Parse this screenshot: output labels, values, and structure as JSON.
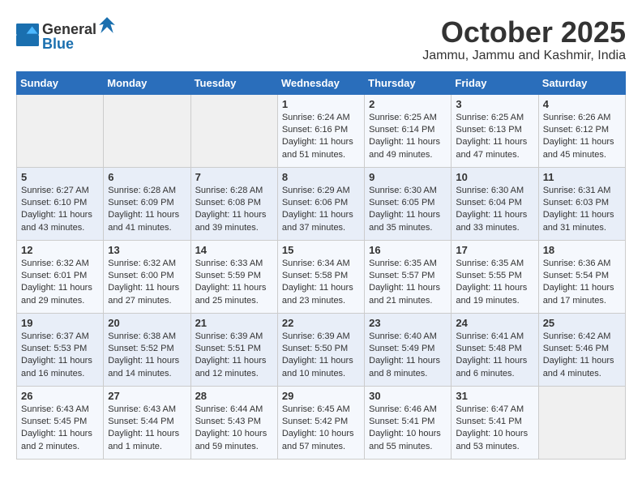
{
  "logo": {
    "general": "General",
    "blue": "Blue"
  },
  "header": {
    "month": "October 2025",
    "location": "Jammu, Jammu and Kashmir, India"
  },
  "weekdays": [
    "Sunday",
    "Monday",
    "Tuesday",
    "Wednesday",
    "Thursday",
    "Friday",
    "Saturday"
  ],
  "weeks": [
    [
      {
        "day": "",
        "sunrise": "",
        "sunset": "",
        "daylight": ""
      },
      {
        "day": "",
        "sunrise": "",
        "sunset": "",
        "daylight": ""
      },
      {
        "day": "",
        "sunrise": "",
        "sunset": "",
        "daylight": ""
      },
      {
        "day": "1",
        "sunrise": "Sunrise: 6:24 AM",
        "sunset": "Sunset: 6:16 PM",
        "daylight": "Daylight: 11 hours and 51 minutes."
      },
      {
        "day": "2",
        "sunrise": "Sunrise: 6:25 AM",
        "sunset": "Sunset: 6:14 PM",
        "daylight": "Daylight: 11 hours and 49 minutes."
      },
      {
        "day": "3",
        "sunrise": "Sunrise: 6:25 AM",
        "sunset": "Sunset: 6:13 PM",
        "daylight": "Daylight: 11 hours and 47 minutes."
      },
      {
        "day": "4",
        "sunrise": "Sunrise: 6:26 AM",
        "sunset": "Sunset: 6:12 PM",
        "daylight": "Daylight: 11 hours and 45 minutes."
      }
    ],
    [
      {
        "day": "5",
        "sunrise": "Sunrise: 6:27 AM",
        "sunset": "Sunset: 6:10 PM",
        "daylight": "Daylight: 11 hours and 43 minutes."
      },
      {
        "day": "6",
        "sunrise": "Sunrise: 6:28 AM",
        "sunset": "Sunset: 6:09 PM",
        "daylight": "Daylight: 11 hours and 41 minutes."
      },
      {
        "day": "7",
        "sunrise": "Sunrise: 6:28 AM",
        "sunset": "Sunset: 6:08 PM",
        "daylight": "Daylight: 11 hours and 39 minutes."
      },
      {
        "day": "8",
        "sunrise": "Sunrise: 6:29 AM",
        "sunset": "Sunset: 6:06 PM",
        "daylight": "Daylight: 11 hours and 37 minutes."
      },
      {
        "day": "9",
        "sunrise": "Sunrise: 6:30 AM",
        "sunset": "Sunset: 6:05 PM",
        "daylight": "Daylight: 11 hours and 35 minutes."
      },
      {
        "day": "10",
        "sunrise": "Sunrise: 6:30 AM",
        "sunset": "Sunset: 6:04 PM",
        "daylight": "Daylight: 11 hours and 33 minutes."
      },
      {
        "day": "11",
        "sunrise": "Sunrise: 6:31 AM",
        "sunset": "Sunset: 6:03 PM",
        "daylight": "Daylight: 11 hours and 31 minutes."
      }
    ],
    [
      {
        "day": "12",
        "sunrise": "Sunrise: 6:32 AM",
        "sunset": "Sunset: 6:01 PM",
        "daylight": "Daylight: 11 hours and 29 minutes."
      },
      {
        "day": "13",
        "sunrise": "Sunrise: 6:32 AM",
        "sunset": "Sunset: 6:00 PM",
        "daylight": "Daylight: 11 hours and 27 minutes."
      },
      {
        "day": "14",
        "sunrise": "Sunrise: 6:33 AM",
        "sunset": "Sunset: 5:59 PM",
        "daylight": "Daylight: 11 hours and 25 minutes."
      },
      {
        "day": "15",
        "sunrise": "Sunrise: 6:34 AM",
        "sunset": "Sunset: 5:58 PM",
        "daylight": "Daylight: 11 hours and 23 minutes."
      },
      {
        "day": "16",
        "sunrise": "Sunrise: 6:35 AM",
        "sunset": "Sunset: 5:57 PM",
        "daylight": "Daylight: 11 hours and 21 minutes."
      },
      {
        "day": "17",
        "sunrise": "Sunrise: 6:35 AM",
        "sunset": "Sunset: 5:55 PM",
        "daylight": "Daylight: 11 hours and 19 minutes."
      },
      {
        "day": "18",
        "sunrise": "Sunrise: 6:36 AM",
        "sunset": "Sunset: 5:54 PM",
        "daylight": "Daylight: 11 hours and 17 minutes."
      }
    ],
    [
      {
        "day": "19",
        "sunrise": "Sunrise: 6:37 AM",
        "sunset": "Sunset: 5:53 PM",
        "daylight": "Daylight: 11 hours and 16 minutes."
      },
      {
        "day": "20",
        "sunrise": "Sunrise: 6:38 AM",
        "sunset": "Sunset: 5:52 PM",
        "daylight": "Daylight: 11 hours and 14 minutes."
      },
      {
        "day": "21",
        "sunrise": "Sunrise: 6:39 AM",
        "sunset": "Sunset: 5:51 PM",
        "daylight": "Daylight: 11 hours and 12 minutes."
      },
      {
        "day": "22",
        "sunrise": "Sunrise: 6:39 AM",
        "sunset": "Sunset: 5:50 PM",
        "daylight": "Daylight: 11 hours and 10 minutes."
      },
      {
        "day": "23",
        "sunrise": "Sunrise: 6:40 AM",
        "sunset": "Sunset: 5:49 PM",
        "daylight": "Daylight: 11 hours and 8 minutes."
      },
      {
        "day": "24",
        "sunrise": "Sunrise: 6:41 AM",
        "sunset": "Sunset: 5:48 PM",
        "daylight": "Daylight: 11 hours and 6 minutes."
      },
      {
        "day": "25",
        "sunrise": "Sunrise: 6:42 AM",
        "sunset": "Sunset: 5:46 PM",
        "daylight": "Daylight: 11 hours and 4 minutes."
      }
    ],
    [
      {
        "day": "26",
        "sunrise": "Sunrise: 6:43 AM",
        "sunset": "Sunset: 5:45 PM",
        "daylight": "Daylight: 11 hours and 2 minutes."
      },
      {
        "day": "27",
        "sunrise": "Sunrise: 6:43 AM",
        "sunset": "Sunset: 5:44 PM",
        "daylight": "Daylight: 11 hours and 1 minute."
      },
      {
        "day": "28",
        "sunrise": "Sunrise: 6:44 AM",
        "sunset": "Sunset: 5:43 PM",
        "daylight": "Daylight: 10 hours and 59 minutes."
      },
      {
        "day": "29",
        "sunrise": "Sunrise: 6:45 AM",
        "sunset": "Sunset: 5:42 PM",
        "daylight": "Daylight: 10 hours and 57 minutes."
      },
      {
        "day": "30",
        "sunrise": "Sunrise: 6:46 AM",
        "sunset": "Sunset: 5:41 PM",
        "daylight": "Daylight: 10 hours and 55 minutes."
      },
      {
        "day": "31",
        "sunrise": "Sunrise: 6:47 AM",
        "sunset": "Sunset: 5:41 PM",
        "daylight": "Daylight: 10 hours and 53 minutes."
      },
      {
        "day": "",
        "sunrise": "",
        "sunset": "",
        "daylight": ""
      }
    ]
  ]
}
